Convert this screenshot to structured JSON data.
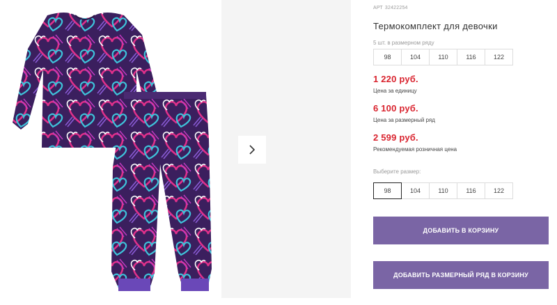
{
  "product": {
    "sku_label": "АРТ",
    "sku_value": "32422254",
    "title": "Термокомплект для девочки"
  },
  "pack": {
    "label": "5 шт. в размерном ряду",
    "sizes": [
      "98",
      "104",
      "110",
      "116",
      "122"
    ]
  },
  "prices": {
    "unit_price": "1 220 руб.",
    "unit_note": "Цена за единицу",
    "row_price": "6 100 руб.",
    "row_note": "Цена за размерный ряд",
    "retail_price": "2 599 руб.",
    "retail_note": "Рекомендуемая розничная цена"
  },
  "size_select": {
    "label": "Выберите размер:",
    "sizes": [
      "98",
      "104",
      "110",
      "116",
      "122"
    ],
    "selected": "98"
  },
  "buttons": {
    "add_to_cart": "ДОБАВИТЬ В КОРЗИНУ",
    "add_row_to_cart": "ДОБАВИТЬ РАЗМЕРНЫЙ РЯД В КОРЗИНУ"
  },
  "gallery": {
    "image_icon": "pajama-product-photo",
    "next_icon": "chevron-right-icon"
  },
  "colors": {
    "price_red": "#d9232e",
    "button_purple": "#7a65a5",
    "gallery_bg": "#f4f4f4",
    "fabric_dark": "#3b1f5e",
    "fabric_pink": "#e0308a",
    "fabric_cyan": "#3ec3da",
    "fabric_violet": "#8a5bd6"
  }
}
